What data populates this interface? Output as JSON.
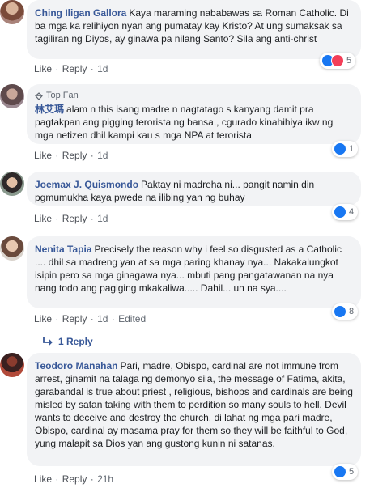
{
  "comments": [
    {
      "name": "Ching Iligan Gallora",
      "text": "Kaya maraming nababawas sa Roman Catholic. Di ba mga ka relihiyon nyan ang pumatay kay Kristo? At ung sumaksak sa tagiliran ng Diyos, ay ginawa pa nilang Santo? Sila ang anti-christ",
      "like": "Like",
      "reply": "Reply",
      "time": "1d",
      "reaction_count": "5"
    },
    {
      "badge": "Top Fan",
      "name": "林艾瑪",
      "text": "alam n this isang madre n nagtatago s kanyang damit pra pagtakpan ang pigging terorista ng bansa., cgurado kinahihiya ikw ng mga netizen dhil kampi kau s mga NPA at terorista",
      "like": "Like",
      "reply": "Reply",
      "time": "1d",
      "reaction_count": "1"
    },
    {
      "name": "Joemax J. Quismondo",
      "text": "Paktay ni madreha ni... pangit namin din pgmumukha kaya pwede na ilibing yan ng buhay",
      "like": "Like",
      "reply": "Reply",
      "time": "1d",
      "reaction_count": "4"
    },
    {
      "name": "Nenita Tapia",
      "text": "Precisely the reason why i feel so disgusted as a Catholic .... dhil sa madreng yan at sa mga paring khanay nya... Nakakalungkot isipin pero sa mga ginagawa nya... mbuti pang pangatawanan na nya nang todo ang pagiging mkakaliwa..... Dahil... un na sya....",
      "like": "Like",
      "reply": "Reply",
      "time": "1d",
      "edited": "Edited",
      "reaction_count": "8"
    },
    {
      "name": "Teodoro Manahan",
      "text": "Pari, madre, Obispo, cardinal are not immune from arrest, ginamit na talaga ng demonyo sila, the message of Fatima, akita, garabandal is true about priest , religious, bishops and cardinals are being misled by satan taking with them to perdition so many souls to hell. Devil wants to deceive and destroy the church, di lahat ng mga pari madre, Obispo, cardinal ay masama pray for them so they will be faithful to God, yung malapit sa Dios yan ang gustong kunin ni satanas.",
      "like": "Like",
      "reply": "Reply",
      "time": "21h",
      "reaction_count": "5"
    }
  ],
  "replies_link": "1 Reply",
  "colors": {
    "name": "#385898",
    "bubble": "#f2f3f5",
    "like": "#1877f2",
    "heart": "#f33e58"
  },
  "icons": [
    "like-icon",
    "love-icon",
    "top-fan-diamond-icon",
    "reply-arrow-icon"
  ]
}
